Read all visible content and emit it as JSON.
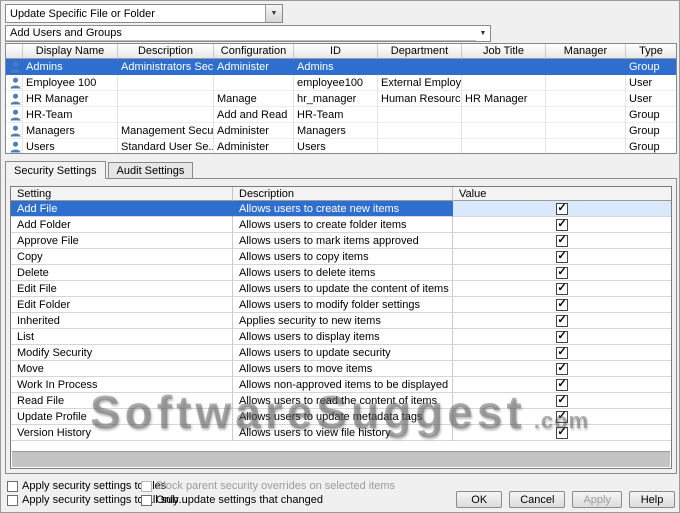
{
  "colors": {
    "selection_blue": "#2e6ecf",
    "selected_value_cell": "#d9e8fb"
  },
  "top": {
    "mode_combobox": {
      "value": "Update Specific File or Folder"
    },
    "add_users_combobox": {
      "value": "Add Users and Groups"
    }
  },
  "users_table": {
    "columns": [
      "Display Name",
      "Description",
      "Configuration",
      "ID",
      "Department",
      "Job Title",
      "Manager",
      "Type"
    ],
    "rows": [
      {
        "display_name": "Admins",
        "description": "Administrators Sec...",
        "configuration": "Administer",
        "id": "Admins",
        "department": "",
        "job_title": "",
        "manager": "",
        "type": "Group",
        "selected": true
      },
      {
        "display_name": "Employee 100",
        "description": "",
        "configuration": "",
        "id": "employee100",
        "department": "External Employee",
        "job_title": "",
        "manager": "",
        "type": "User",
        "selected": false
      },
      {
        "display_name": "HR Manager",
        "description": "",
        "configuration": "Manage",
        "id": "hr_manager",
        "department": "Human Resources",
        "job_title": "HR Manager",
        "manager": "",
        "type": "User",
        "selected": false
      },
      {
        "display_name": "HR-Team",
        "description": "",
        "configuration": "Add and Read",
        "id": "HR-Team",
        "department": "",
        "job_title": "",
        "manager": "",
        "type": "Group",
        "selected": false
      },
      {
        "display_name": "Managers",
        "description": "Management Secu...",
        "configuration": "Administer",
        "id": "Managers",
        "department": "",
        "job_title": "",
        "manager": "",
        "type": "Group",
        "selected": false
      },
      {
        "display_name": "Users",
        "description": "Standard User Se...",
        "configuration": "Administer",
        "id": "Users",
        "department": "",
        "job_title": "",
        "manager": "",
        "type": "Group",
        "selected": false
      }
    ]
  },
  "tabs": [
    {
      "label": "Security Settings",
      "active": true
    },
    {
      "label": "Audit Settings",
      "active": false
    }
  ],
  "settings_table": {
    "columns": [
      "Setting",
      "Description",
      "Value"
    ],
    "rows": [
      {
        "setting": "Add File",
        "description": "Allows users to create new items",
        "checked": true,
        "selected": true
      },
      {
        "setting": "Add Folder",
        "description": "Allows users to create folder items",
        "checked": true,
        "selected": false
      },
      {
        "setting": "Approve File",
        "description": "Allows users to mark items approved",
        "checked": true,
        "selected": false
      },
      {
        "setting": "Copy",
        "description": "Allows users to copy items",
        "checked": true,
        "selected": false
      },
      {
        "setting": "Delete",
        "description": "Allows users to delete items",
        "checked": true,
        "selected": false
      },
      {
        "setting": "Edit File",
        "description": "Allows users to update the content of items",
        "checked": true,
        "selected": false
      },
      {
        "setting": "Edit Folder",
        "description": "Allows users to modify folder settings",
        "checked": true,
        "selected": false
      },
      {
        "setting": "Inherited",
        "description": "Applies security to new items",
        "checked": true,
        "selected": false
      },
      {
        "setting": "List",
        "description": "Allows users to display items",
        "checked": true,
        "selected": false
      },
      {
        "setting": "Modify Security",
        "description": "Allows users to update security",
        "checked": true,
        "selected": false
      },
      {
        "setting": "Move",
        "description": "Allows users to move items",
        "checked": true,
        "selected": false
      },
      {
        "setting": "Work In Process",
        "description": "Allows non-approved items to be displayed",
        "checked": true,
        "selected": false
      },
      {
        "setting": "Read File",
        "description": "Allows users to read the content of items",
        "checked": true,
        "selected": false
      },
      {
        "setting": "Update Profile",
        "description": "Allows users to update metadata tags",
        "checked": true,
        "selected": false
      },
      {
        "setting": "Version History",
        "description": "Allows users to view file history",
        "checked": true,
        "selected": false
      }
    ]
  },
  "watermark": {
    "main": "SoftwareSuggest",
    "suffix": ".com"
  },
  "footer": {
    "checkboxes": [
      {
        "label": "Apply security settings to files",
        "checked": false,
        "enabled": true
      },
      {
        "label": "Block parent security overrides on selected items",
        "checked": false,
        "enabled": false
      },
      {
        "label": "Apply security settings to all sub...",
        "checked": false,
        "enabled": true
      },
      {
        "label": "Only update settings that changed",
        "checked": false,
        "enabled": true
      }
    ],
    "buttons": [
      {
        "name": "ok-button",
        "label": "OK",
        "enabled": true
      },
      {
        "name": "cancel-button",
        "label": "Cancel",
        "enabled": true
      },
      {
        "name": "apply-button",
        "label": "Apply",
        "enabled": false
      },
      {
        "name": "help-button",
        "label": "Help",
        "enabled": true
      }
    ]
  }
}
